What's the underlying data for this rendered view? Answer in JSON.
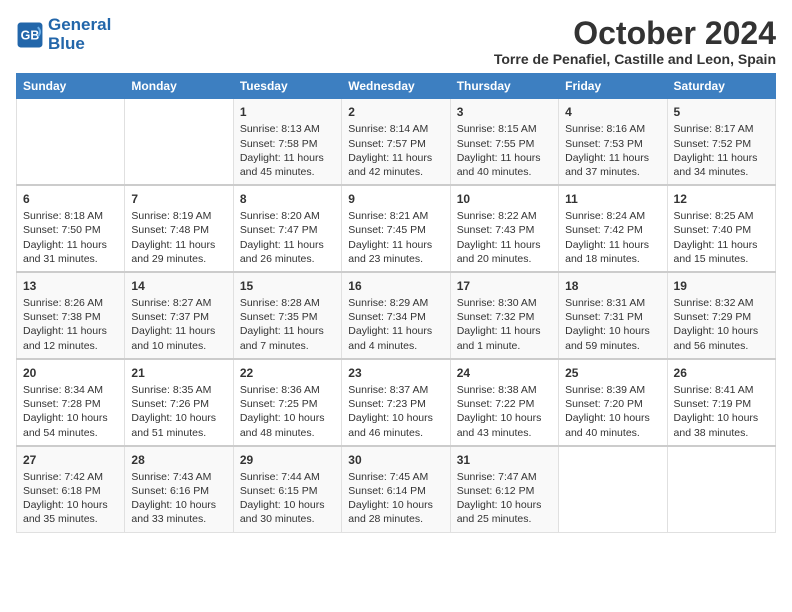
{
  "logo": {
    "line1": "General",
    "line2": "Blue"
  },
  "title": "October 2024",
  "subtitle": "Torre de Penafiel, Castille and Leon, Spain",
  "headers": [
    "Sunday",
    "Monday",
    "Tuesday",
    "Wednesday",
    "Thursday",
    "Friday",
    "Saturday"
  ],
  "weeks": [
    [
      {
        "day": "",
        "sunrise": "",
        "sunset": "",
        "daylight": ""
      },
      {
        "day": "",
        "sunrise": "",
        "sunset": "",
        "daylight": ""
      },
      {
        "day": "1",
        "sunrise": "Sunrise: 8:13 AM",
        "sunset": "Sunset: 7:58 PM",
        "daylight": "Daylight: 11 hours and 45 minutes."
      },
      {
        "day": "2",
        "sunrise": "Sunrise: 8:14 AM",
        "sunset": "Sunset: 7:57 PM",
        "daylight": "Daylight: 11 hours and 42 minutes."
      },
      {
        "day": "3",
        "sunrise": "Sunrise: 8:15 AM",
        "sunset": "Sunset: 7:55 PM",
        "daylight": "Daylight: 11 hours and 40 minutes."
      },
      {
        "day": "4",
        "sunrise": "Sunrise: 8:16 AM",
        "sunset": "Sunset: 7:53 PM",
        "daylight": "Daylight: 11 hours and 37 minutes."
      },
      {
        "day": "5",
        "sunrise": "Sunrise: 8:17 AM",
        "sunset": "Sunset: 7:52 PM",
        "daylight": "Daylight: 11 hours and 34 minutes."
      }
    ],
    [
      {
        "day": "6",
        "sunrise": "Sunrise: 8:18 AM",
        "sunset": "Sunset: 7:50 PM",
        "daylight": "Daylight: 11 hours and 31 minutes."
      },
      {
        "day": "7",
        "sunrise": "Sunrise: 8:19 AM",
        "sunset": "Sunset: 7:48 PM",
        "daylight": "Daylight: 11 hours and 29 minutes."
      },
      {
        "day": "8",
        "sunrise": "Sunrise: 8:20 AM",
        "sunset": "Sunset: 7:47 PM",
        "daylight": "Daylight: 11 hours and 26 minutes."
      },
      {
        "day": "9",
        "sunrise": "Sunrise: 8:21 AM",
        "sunset": "Sunset: 7:45 PM",
        "daylight": "Daylight: 11 hours and 23 minutes."
      },
      {
        "day": "10",
        "sunrise": "Sunrise: 8:22 AM",
        "sunset": "Sunset: 7:43 PM",
        "daylight": "Daylight: 11 hours and 20 minutes."
      },
      {
        "day": "11",
        "sunrise": "Sunrise: 8:24 AM",
        "sunset": "Sunset: 7:42 PM",
        "daylight": "Daylight: 11 hours and 18 minutes."
      },
      {
        "day": "12",
        "sunrise": "Sunrise: 8:25 AM",
        "sunset": "Sunset: 7:40 PM",
        "daylight": "Daylight: 11 hours and 15 minutes."
      }
    ],
    [
      {
        "day": "13",
        "sunrise": "Sunrise: 8:26 AM",
        "sunset": "Sunset: 7:38 PM",
        "daylight": "Daylight: 11 hours and 12 minutes."
      },
      {
        "day": "14",
        "sunrise": "Sunrise: 8:27 AM",
        "sunset": "Sunset: 7:37 PM",
        "daylight": "Daylight: 11 hours and 10 minutes."
      },
      {
        "day": "15",
        "sunrise": "Sunrise: 8:28 AM",
        "sunset": "Sunset: 7:35 PM",
        "daylight": "Daylight: 11 hours and 7 minutes."
      },
      {
        "day": "16",
        "sunrise": "Sunrise: 8:29 AM",
        "sunset": "Sunset: 7:34 PM",
        "daylight": "Daylight: 11 hours and 4 minutes."
      },
      {
        "day": "17",
        "sunrise": "Sunrise: 8:30 AM",
        "sunset": "Sunset: 7:32 PM",
        "daylight": "Daylight: 11 hours and 1 minute."
      },
      {
        "day": "18",
        "sunrise": "Sunrise: 8:31 AM",
        "sunset": "Sunset: 7:31 PM",
        "daylight": "Daylight: 10 hours and 59 minutes."
      },
      {
        "day": "19",
        "sunrise": "Sunrise: 8:32 AM",
        "sunset": "Sunset: 7:29 PM",
        "daylight": "Daylight: 10 hours and 56 minutes."
      }
    ],
    [
      {
        "day": "20",
        "sunrise": "Sunrise: 8:34 AM",
        "sunset": "Sunset: 7:28 PM",
        "daylight": "Daylight: 10 hours and 54 minutes."
      },
      {
        "day": "21",
        "sunrise": "Sunrise: 8:35 AM",
        "sunset": "Sunset: 7:26 PM",
        "daylight": "Daylight: 10 hours and 51 minutes."
      },
      {
        "day": "22",
        "sunrise": "Sunrise: 8:36 AM",
        "sunset": "Sunset: 7:25 PM",
        "daylight": "Daylight: 10 hours and 48 minutes."
      },
      {
        "day": "23",
        "sunrise": "Sunrise: 8:37 AM",
        "sunset": "Sunset: 7:23 PM",
        "daylight": "Daylight: 10 hours and 46 minutes."
      },
      {
        "day": "24",
        "sunrise": "Sunrise: 8:38 AM",
        "sunset": "Sunset: 7:22 PM",
        "daylight": "Daylight: 10 hours and 43 minutes."
      },
      {
        "day": "25",
        "sunrise": "Sunrise: 8:39 AM",
        "sunset": "Sunset: 7:20 PM",
        "daylight": "Daylight: 10 hours and 40 minutes."
      },
      {
        "day": "26",
        "sunrise": "Sunrise: 8:41 AM",
        "sunset": "Sunset: 7:19 PM",
        "daylight": "Daylight: 10 hours and 38 minutes."
      }
    ],
    [
      {
        "day": "27",
        "sunrise": "Sunrise: 7:42 AM",
        "sunset": "Sunset: 6:18 PM",
        "daylight": "Daylight: 10 hours and 35 minutes."
      },
      {
        "day": "28",
        "sunrise": "Sunrise: 7:43 AM",
        "sunset": "Sunset: 6:16 PM",
        "daylight": "Daylight: 10 hours and 33 minutes."
      },
      {
        "day": "29",
        "sunrise": "Sunrise: 7:44 AM",
        "sunset": "Sunset: 6:15 PM",
        "daylight": "Daylight: 10 hours and 30 minutes."
      },
      {
        "day": "30",
        "sunrise": "Sunrise: 7:45 AM",
        "sunset": "Sunset: 6:14 PM",
        "daylight": "Daylight: 10 hours and 28 minutes."
      },
      {
        "day": "31",
        "sunrise": "Sunrise: 7:47 AM",
        "sunset": "Sunset: 6:12 PM",
        "daylight": "Daylight: 10 hours and 25 minutes."
      },
      {
        "day": "",
        "sunrise": "",
        "sunset": "",
        "daylight": ""
      },
      {
        "day": "",
        "sunrise": "",
        "sunset": "",
        "daylight": ""
      }
    ]
  ]
}
